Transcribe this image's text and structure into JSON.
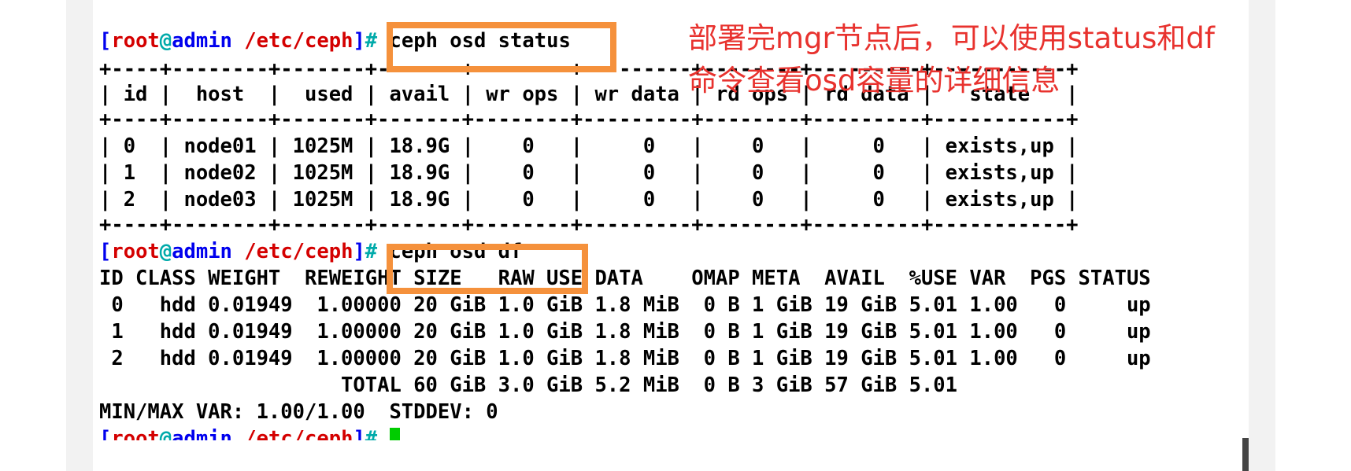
{
  "prompt": {
    "root": "root",
    "at": "@",
    "host": "admin",
    "path": "/etc/ceph"
  },
  "commands": {
    "status": "ceph osd status",
    "df": "ceph osd df"
  },
  "status_table": {
    "border": "+----+--------+-------+-------+--------+---------+--------+---------+-----------+",
    "header": "| id |  host  |  used | avail | wr ops | wr data | rd ops | rd data |   state   |",
    "rows": [
      "| 0  | node01 | 1025M | 18.9G |    0   |     0   |    0   |     0   | exists,up |",
      "| 1  | node02 | 1025M | 18.9G |    0   |     0   |    0   |     0   | exists,up |",
      "| 2  | node03 | 1025M | 18.9G |    0   |     0   |    0   |     0   | exists,up |"
    ]
  },
  "df_table": {
    "header": "ID CLASS WEIGHT  REWEIGHT SIZE   RAW USE DATA    OMAP META  AVAIL  %USE VAR  PGS STATUS",
    "rows": [
      " 0   hdd 0.01949  1.00000 20 GiB 1.0 GiB 1.8 MiB  0 B 1 GiB 19 GiB 5.01 1.00   0     up",
      " 1   hdd 0.01949  1.00000 20 GiB 1.0 GiB 1.8 MiB  0 B 1 GiB 19 GiB 5.01 1.00   0     up",
      " 2   hdd 0.01949  1.00000 20 GiB 1.0 GiB 1.8 MiB  0 B 1 GiB 19 GiB 5.01 1.00   0     up"
    ],
    "total": "                    TOTAL 60 GiB 3.0 GiB 5.2 MiB  0 B 3 GiB 57 GiB 5.01",
    "minmax": "MIN/MAX VAR: 1.00/1.00  STDDEV: 0"
  },
  "annotation": {
    "line1": "部署完mgr节点后，可以使用status和df",
    "line2": "命令查看osd容量的详细信息"
  },
  "colors": {
    "highlight_box": "#f5913c",
    "annotation_text": "#e8322e",
    "cursor": "#00cc00"
  }
}
